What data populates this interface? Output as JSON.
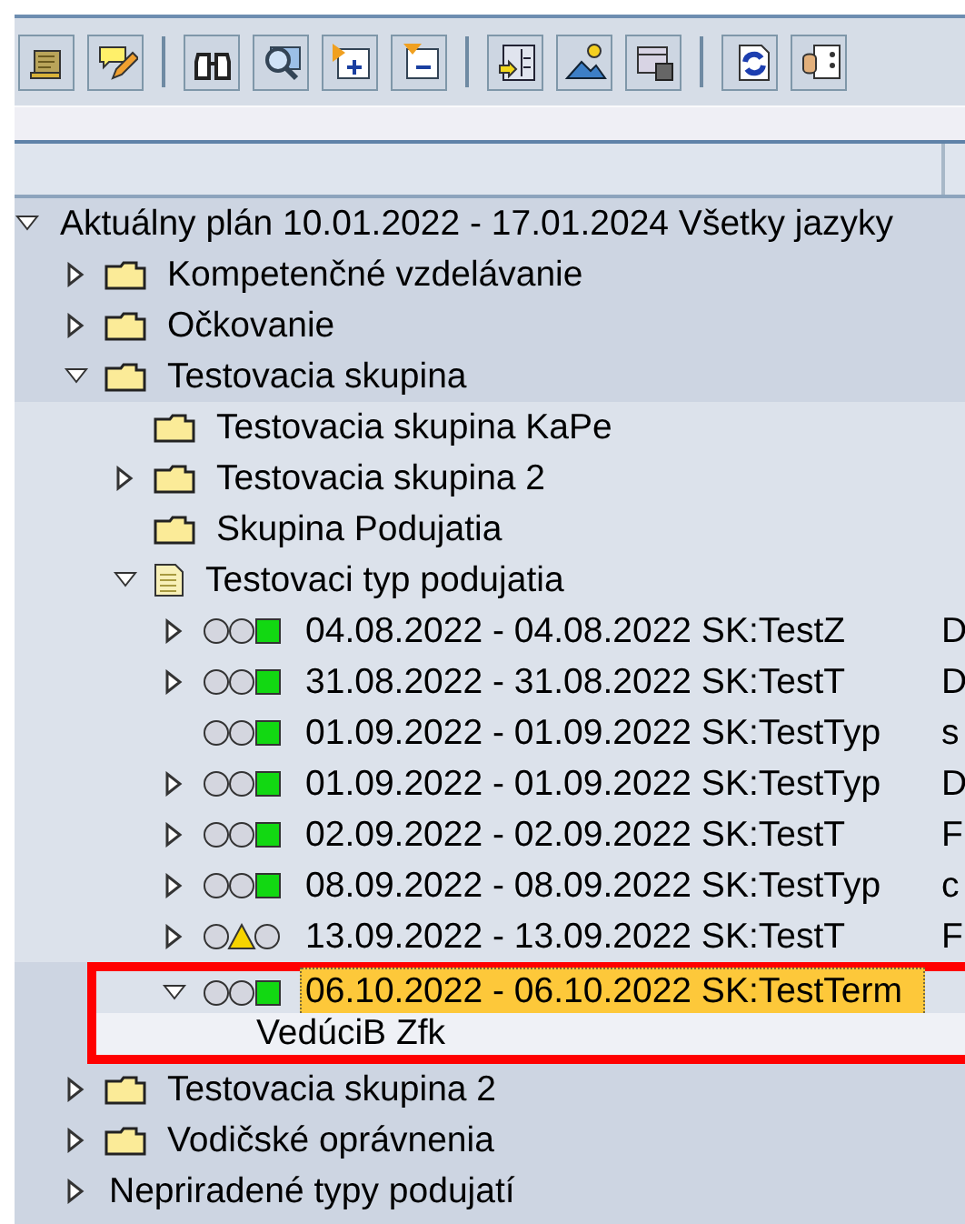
{
  "tree": {
    "nodes": [
      {
        "label": "Aktuálny plán 10.01.2022 - 17.01.2024 Všetky jazyky",
        "expanded": true,
        "children": [
          {
            "label": "Kompetenčné vzdelávanie",
            "kind": "folder",
            "expanded": false
          },
          {
            "label": "Očkovanie",
            "kind": "folder",
            "expanded": false
          },
          {
            "label": "Testovacia skupina",
            "kind": "folder",
            "expanded": true,
            "children": [
              {
                "label": "Testovacia skupina KaPe",
                "kind": "folder"
              },
              {
                "label": "Testovacia skupina 2",
                "kind": "folder",
                "expanded": false
              },
              {
                "label": "Skupina Podujatia",
                "kind": "folder"
              },
              {
                "label": "Testovaci typ podujatia",
                "kind": "document",
                "expanded": true,
                "children": [
                  {
                    "label": "04.08.2022 - 04.08.2022 SK:TestZ",
                    "kind": "event",
                    "warning": false,
                    "expanded": false,
                    "column_2": "D",
                    "selected": false,
                    "framed": false
                  },
                  {
                    "label": "31.08.2022 - 31.08.2022 SK:TestT",
                    "kind": "event",
                    "warning": false,
                    "expanded": false,
                    "column_2": "D",
                    "selected": false,
                    "framed": false
                  },
                  {
                    "label": "01.09.2022 - 01.09.2022 SK:TestTyp",
                    "kind": "event",
                    "warning": false,
                    "column_2": "s",
                    "selected": false,
                    "framed": false
                  },
                  {
                    "label": "01.09.2022 - 01.09.2022 SK:TestTyp",
                    "kind": "event",
                    "warning": false,
                    "expanded": false,
                    "column_2": "D",
                    "selected": false,
                    "framed": false
                  },
                  {
                    "label": "02.09.2022 - 02.09.2022 SK:TestT",
                    "kind": "event",
                    "warning": false,
                    "expanded": false,
                    "column_2": "F",
                    "selected": false,
                    "framed": false
                  },
                  {
                    "label": "08.09.2022 - 08.09.2022 SK:TestTyp",
                    "kind": "event",
                    "warning": false,
                    "expanded": false,
                    "column_2": "c",
                    "selected": false,
                    "framed": false
                  },
                  {
                    "label": "13.09.2022 - 13.09.2022 SK:TestT",
                    "kind": "event",
                    "warning": true,
                    "expanded": false,
                    "column_2": "F",
                    "selected": false,
                    "framed": false
                  },
                  {
                    "label": "06.10.2022 - 06.10.2022 SK:TestTerm",
                    "kind": "event",
                    "warning": false,
                    "expanded": true,
                    "selected": true,
                    "framed": true,
                    "children": [
                      {
                        "label": "VedúciB Zfk"
                      }
                    ]
                  }
                ]
              }
            ]
          },
          {
            "label": "Testovacia skupina 2",
            "kind": "folder",
            "expanded": false
          },
          {
            "label": "Vodičské oprávnenia",
            "kind": "folder",
            "expanded": false
          },
          {
            "label": "Nepriradené typy podujatí",
            "expanded": false
          }
        ]
      }
    ]
  }
}
